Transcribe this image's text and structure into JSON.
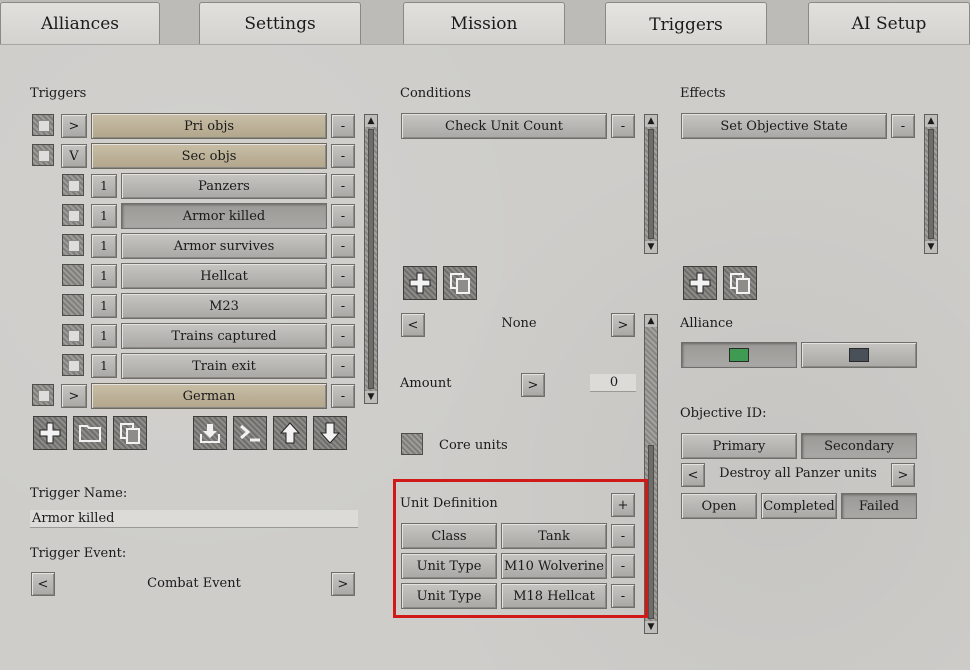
{
  "tabs": [
    {
      "label": "Alliances"
    },
    {
      "label": "Settings"
    },
    {
      "label": "Mission"
    },
    {
      "label": "Triggers",
      "active": true
    },
    {
      "label": "AI Setup"
    }
  ],
  "triggers": {
    "header": "Triggers",
    "rows": [
      {
        "toggle": ">",
        "label": "Pri objs",
        "group": true
      },
      {
        "toggle": "V",
        "label": "Sec objs",
        "group": true
      },
      {
        "num": "1",
        "label": "Panzers"
      },
      {
        "num": "1",
        "label": "Armor killed",
        "selected": true
      },
      {
        "num": "1",
        "label": "Armor survives"
      },
      {
        "num": "1",
        "label": "Hellcat"
      },
      {
        "num": "1",
        "label": "M23"
      },
      {
        "num": "1",
        "label": "Trains captured"
      },
      {
        "num": "1",
        "label": "Train exit"
      },
      {
        "toggle": ">",
        "label": "German",
        "group": true
      }
    ],
    "remove_label": "-",
    "trigger_name_label": "Trigger Name:",
    "trigger_name_value": "Armor killed",
    "trigger_event_label": "Trigger Event:",
    "trigger_event_value": "Combat Event",
    "prev": "<",
    "next": ">"
  },
  "conditions": {
    "header": "Conditions",
    "items": [
      {
        "label": "Check Unit Count"
      }
    ],
    "remove_label": "-",
    "selector_value": "None",
    "prev": "<",
    "next": ">",
    "amount_label": "Amount",
    "amount_btn": ">",
    "amount_value": "0",
    "core_units_label": "Core units",
    "unit_definition_label": "Unit Definition",
    "add_label": "+",
    "unit_rows": [
      {
        "key": "Class",
        "value": "Tank"
      },
      {
        "key": "Unit Type",
        "value": "M10 Wolverine"
      },
      {
        "key": "Unit Type",
        "value": "M18 Hellcat"
      }
    ]
  },
  "effects": {
    "header": "Effects",
    "items": [
      {
        "label": "Set Objective State"
      }
    ],
    "remove_label": "-",
    "alliance_label": "Alliance",
    "alliance_colors": [
      "#3f9a52",
      "#4a5058"
    ],
    "objective_id_label": "Objective ID:",
    "primary_label": "Primary",
    "secondary_label": "Secondary",
    "objective_value": "Destroy all Panzer units",
    "prev": "<",
    "next": ">",
    "state_buttons": [
      "Open",
      "Completed",
      "Failed"
    ]
  }
}
